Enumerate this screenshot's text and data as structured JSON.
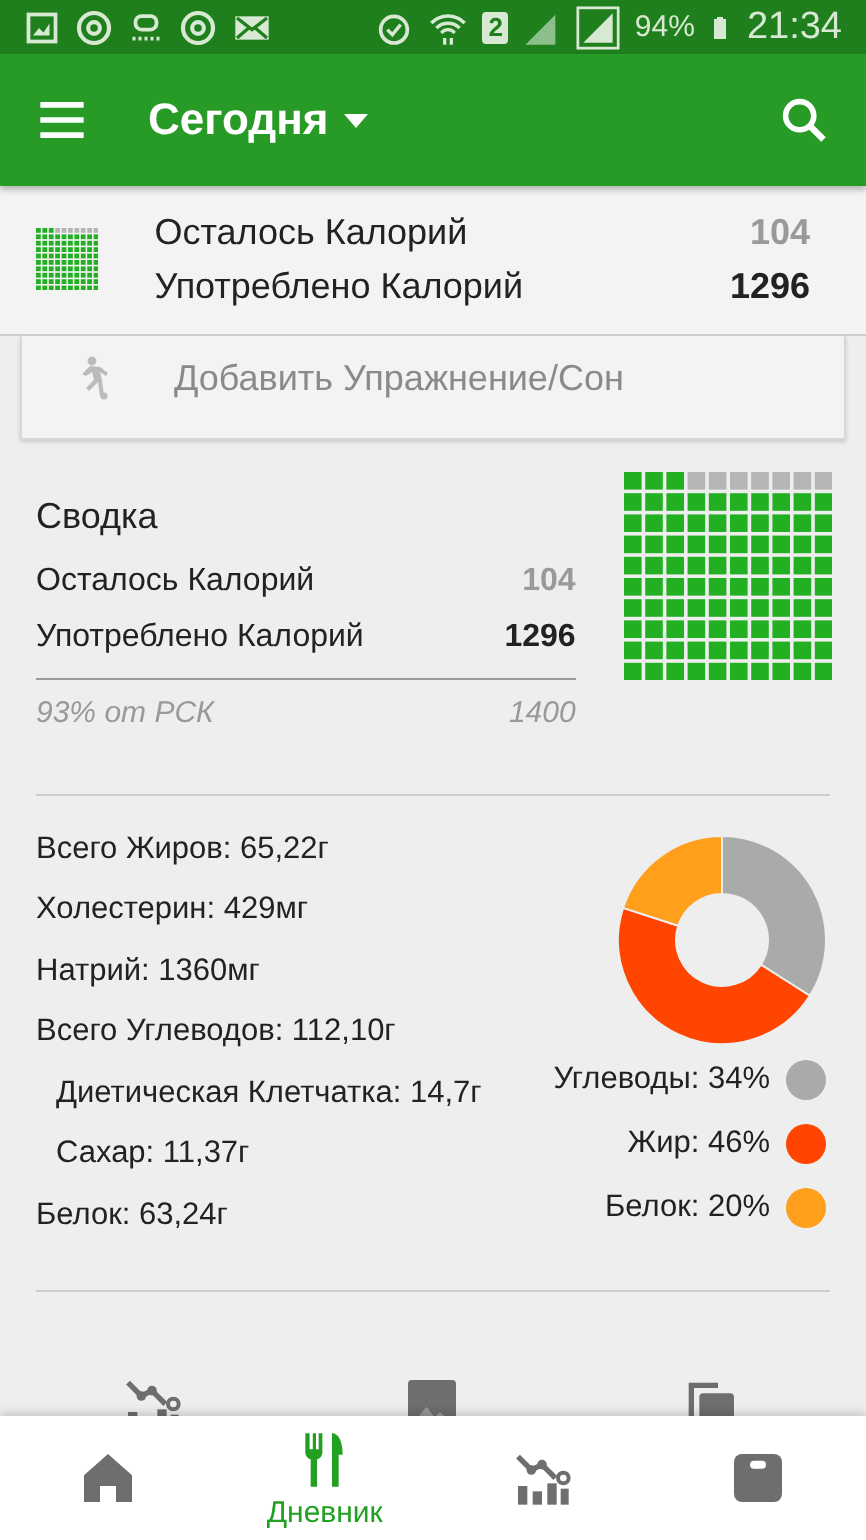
{
  "status_bar": {
    "sim_label": "2",
    "battery": "94%",
    "time": "21:34"
  },
  "toolbar": {
    "title": "Сегодня"
  },
  "header": {
    "remaining_label": "Осталось Калорий",
    "remaining": "104",
    "consumed_label": "Употреблено Калорий",
    "consumed": "1296"
  },
  "add_action": {
    "label": "Добавить Упражнение/Сон"
  },
  "summary": {
    "title": "Сводка",
    "rows": [
      {
        "label": "Осталось Калорий",
        "value": "104",
        "kind": "muted"
      },
      {
        "label": "Употреблено Калорий",
        "value": "1296",
        "kind": "bold"
      }
    ],
    "footer_label": "93% от РСК",
    "footer_value": "1400",
    "level": 0.93
  },
  "nutrients": {
    "items": [
      {
        "label": "Всего Жиров: 65,22г"
      },
      {
        "label": "Холестерин: 429мг"
      },
      {
        "label": "Натрий: 1360мг"
      },
      {
        "label": "Всего Углеводов: 112,10г",
        "children": [
          {
            "label": "Диетическая Клетчатка: 14,7г"
          },
          {
            "label": "Сахар: 11,37г"
          }
        ]
      },
      {
        "label": "Белок: 63,24г"
      }
    ],
    "legend": [
      {
        "label": "Углеводы: 34%",
        "color": "#aaaaaa"
      },
      {
        "label": "Жир: 46%",
        "color": "#ff4500"
      },
      {
        "label": "Белок: 20%",
        "color": "#ff9f1c"
      }
    ],
    "chart_data": {
      "type": "donut",
      "values": [
        34,
        46,
        20
      ]
    }
  },
  "peek_icons": [
    {
      "kind": "progress"
    },
    {
      "kind": "image"
    },
    {
      "kind": "copy"
    }
  ],
  "bottom_nav": [
    {
      "kind": "home",
      "selected": false
    },
    {
      "kind": "diary",
      "label": "Дневник",
      "selected": true
    },
    {
      "kind": "progress",
      "selected": false
    },
    {
      "kind": "scale",
      "selected": false
    }
  ]
}
